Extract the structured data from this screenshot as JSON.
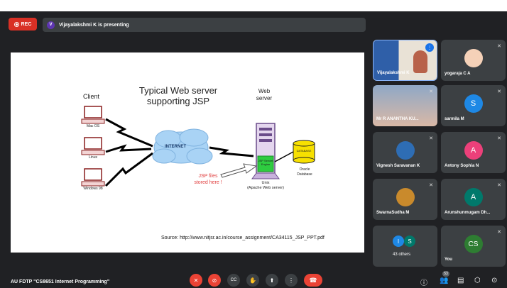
{
  "recording": {
    "label": "REC"
  },
  "presenter": {
    "avatar_initial": "V",
    "text": "Vijayalakshmi K is presenting"
  },
  "slide": {
    "title_line1": "Typical Web server",
    "title_line2": "supporting JSP",
    "client_label": "Client",
    "web_server_label1": "Web",
    "web_server_label2": "server",
    "internet_label": "INTERNET",
    "clients": [
      "Mac OS",
      "Linux",
      "Windows 98"
    ],
    "jsp_note_line1": "JSP files",
    "jsp_note_line2": "stored here !",
    "engine_label": "JSP Servlet Engine",
    "server_os_line1": "Unix",
    "server_os_line2": "(Apache Web server)",
    "database_chip": "DATABASE",
    "database_label1": "Oracle",
    "database_label2": "Database",
    "source": "Source: http://www.nitjsr.ac.in/course_assignment/CA34115_JSP_PPT.pdf"
  },
  "participants": [
    {
      "name": "Vijayalakshmi K",
      "type": "video"
    },
    {
      "name": "yogaraja C A",
      "type": "photo"
    },
    {
      "name": "Mr R ANANTHA KU...",
      "type": "video2"
    },
    {
      "name": "sarmila M",
      "initial": "S",
      "color": "#1e88e5"
    },
    {
      "name": "Vignesh Saravanan K",
      "type": "photo2"
    },
    {
      "name": "Antony Sophia N",
      "initial": "A",
      "color": "#ec407a"
    },
    {
      "name": "SwarnaSudha M",
      "type": "photo3"
    },
    {
      "name": "Arunshunmugam Dh...",
      "initial": "A",
      "color": "#00796b"
    },
    {
      "name": "43 others",
      "initials": [
        "I",
        "S"
      ]
    },
    {
      "name": "You",
      "initial": "CS",
      "color": "#2e7d32"
    }
  ],
  "meeting": {
    "title": "AU FDTP \"CS8651 Internet Programming\"",
    "participant_count": "53"
  },
  "icons": [
    "mic-off-icon",
    "camera-off-icon",
    "captions-icon",
    "raise-hand-icon",
    "present-icon",
    "more-icon",
    "end-call-icon",
    "info-icon",
    "people-icon",
    "chat-icon",
    "activities-icon",
    "lock-icon"
  ]
}
